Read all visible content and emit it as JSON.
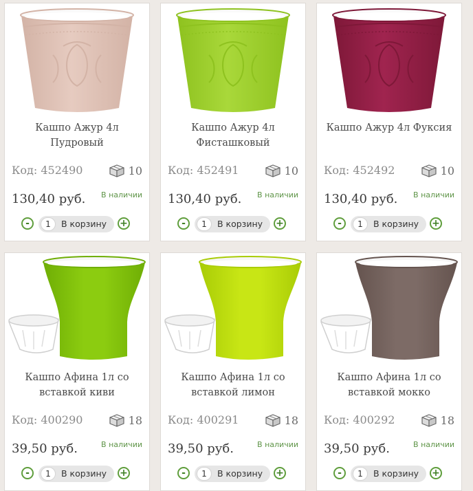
{
  "products": [
    {
      "title": "Кашпо Ажур 4л Пудровый",
      "code": "Код: 452490",
      "stock": "10",
      "price": "130,40 руб.",
      "availability": "В наличии",
      "qty": "1",
      "cart_label": "В корзину",
      "pot_style": "ajur",
      "color": "#e6cbc0",
      "color_dark": "#d3b3a6",
      "icon": "box-icon"
    },
    {
      "title": "Кашпо Ажур 4л Фисташковый",
      "code": "Код: 452491",
      "stock": "10",
      "price": "130,40 руб.",
      "availability": "В наличии",
      "qty": "1",
      "cart_label": "В корзину",
      "pot_style": "ajur",
      "color": "#a9d83a",
      "color_dark": "#8ec21f",
      "icon": "box-icon"
    },
    {
      "title": "Кашпо Ажур 4л Фуксия",
      "code": "Код: 452492",
      "stock": "10",
      "price": "130,40 руб.",
      "availability": "В наличии",
      "qty": "1",
      "cart_label": "В корзину",
      "pot_style": "ajur",
      "color": "#a0244f",
      "color_dark": "#7e1838",
      "icon": "box-icon"
    },
    {
      "title": "Кашпо Афина 1л со вставкой киви",
      "code": "Код: 400290",
      "stock": "18",
      "price": "39,50 руб.",
      "availability": "В наличии",
      "qty": "1",
      "cart_label": "В корзину",
      "pot_style": "afina",
      "color": "#8ccc10",
      "color_dark": "#6fae05",
      "icon": "box-icon"
    },
    {
      "title": "Кашпо Афина 1л со вставкой лимон",
      "code": "Код: 400291",
      "stock": "18",
      "price": "39,50 руб.",
      "availability": "В наличии",
      "qty": "1",
      "cart_label": "В корзину",
      "pot_style": "afina",
      "color": "#c8e615",
      "color_dark": "#a9cc06",
      "icon": "box-icon"
    },
    {
      "title": "Кашпо Афина 1л со вставкой мокко",
      "code": "Код: 400292",
      "stock": "18",
      "price": "39,50 руб.",
      "availability": "В наличии",
      "qty": "1",
      "cart_label": "В корзину",
      "pot_style": "afina",
      "color": "#7d6b66",
      "color_dark": "#65544f",
      "icon": "box-icon"
    }
  ]
}
